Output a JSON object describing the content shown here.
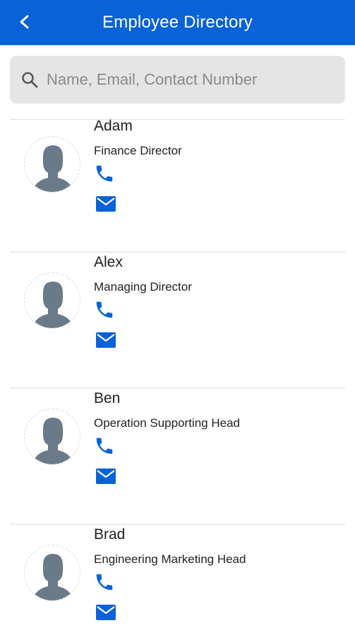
{
  "header": {
    "title": "Employee Directory",
    "back_icon": "chevron-left-icon",
    "background_color": "#0a63d6"
  },
  "search": {
    "placeholder": "Name, Email, Contact Number",
    "value": "",
    "icon": "search-icon"
  },
  "employees": [
    {
      "name": "Adam",
      "role": "Finance Director"
    },
    {
      "name": "Alex",
      "role": "Managing Director"
    },
    {
      "name": "Ben",
      "role": "Operation Supporting Head"
    },
    {
      "name": "Brad",
      "role": "Engineering Marketing Head"
    }
  ],
  "icons": {
    "avatar": "person-avatar-icon",
    "phone": "phone-icon",
    "mail": "mail-icon"
  },
  "colors": {
    "accent": "#0a63d6",
    "avatar_silhouette": "#6b7a89",
    "search_bg": "#e5e5e5"
  }
}
